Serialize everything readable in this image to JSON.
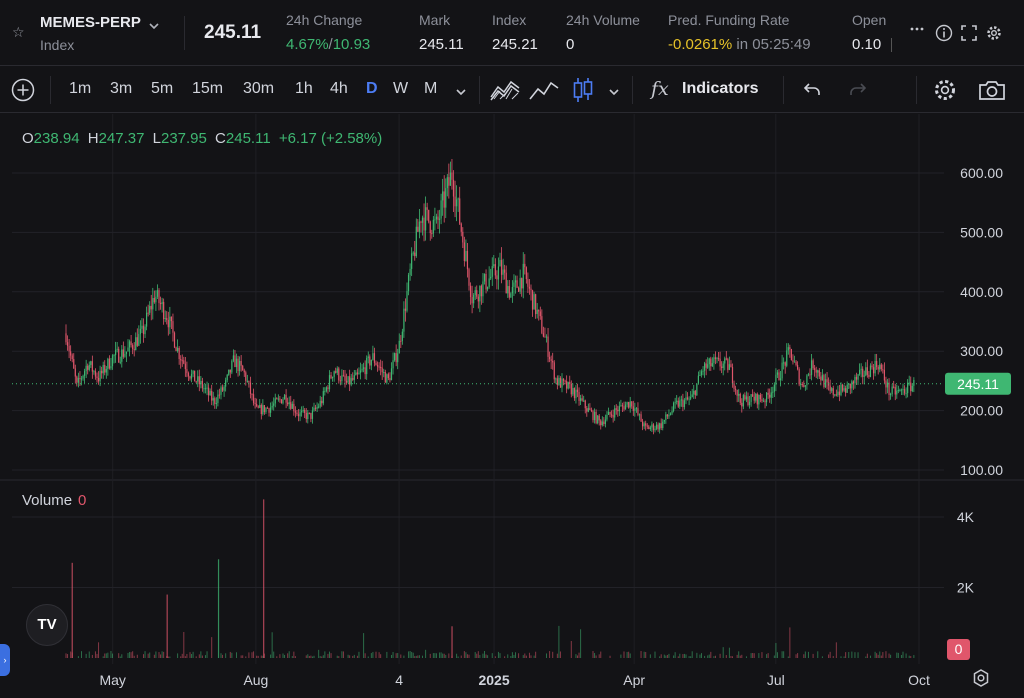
{
  "header": {
    "symbol": "MEMES-PERP",
    "symbol_sub": "Index",
    "last_price": "245.11",
    "change_label": "24h Change",
    "change_pct": "4.67%",
    "change_sep": "/",
    "change_abs": "10.93",
    "mark_label": "Mark",
    "mark_value": "245.11",
    "index_label": "Index",
    "index_value": "245.21",
    "volume_label": "24h Volume",
    "volume_value": "0",
    "funding_label": "Pred. Funding Rate",
    "funding_rate": "-0.0261%",
    "funding_in": "in 05:25:49",
    "open_label": "Open",
    "open_value": "0.10"
  },
  "icons": {
    "star": "star-icon",
    "chevron": "chevron-down-icon",
    "more": "more-icon",
    "info": "info-icon",
    "fullscreen": "fullscreen-icon",
    "settings": "gear-icon"
  },
  "toolbar": {
    "timeframes": [
      "1m",
      "3m",
      "5m",
      "15m",
      "30m",
      "1h",
      "4h",
      "D",
      "W",
      "M"
    ],
    "active_timeframe": "D",
    "indicators_label": "Indicators",
    "indicators_glyph": "fx"
  },
  "legend": {
    "o_key": "O",
    "o_val": "238.94",
    "h_key": "H",
    "h_val": "247.37",
    "l_key": "L",
    "l_val": "237.95",
    "c_key": "C",
    "c_val": "245.11",
    "change": "+6.17 (+2.58%)"
  },
  "volume_pane": {
    "label": "Volume",
    "value": "0",
    "badge": "0"
  },
  "logo": "TV",
  "colors": {
    "up": "#3fb772",
    "down": "#e0566b",
    "accent": "#4c7cf3",
    "funding": "#e6c229",
    "background": "#131316"
  },
  "chart_data": {
    "type": "candlestick",
    "price_axis_ticks": [
      "600.00",
      "500.00",
      "400.00",
      "300.00",
      "200.00",
      "100.00"
    ],
    "price_axis_values": [
      600,
      500,
      400,
      300,
      200,
      100
    ],
    "volume_axis_ticks": [
      "4K",
      "2K"
    ],
    "volume_axis_values": [
      4000,
      2000
    ],
    "time_axis_ticks": [
      "May",
      "Aug",
      "4",
      "2025",
      "Apr",
      "Jul",
      "Oct"
    ],
    "last_price_badge": "245.11",
    "last_price_value": 245.11,
    "close_path": [
      {
        "date": "2024-04-01",
        "close": 330
      },
      {
        "date": "2024-04-08",
        "close": 240
      },
      {
        "date": "2024-04-15",
        "close": 280
      },
      {
        "date": "2024-04-22",
        "close": 255
      },
      {
        "date": "2024-05-01",
        "close": 290
      },
      {
        "date": "2024-05-10",
        "close": 300
      },
      {
        "date": "2024-05-20",
        "close": 330
      },
      {
        "date": "2024-05-28",
        "close": 395
      },
      {
        "date": "2024-06-05",
        "close": 360
      },
      {
        "date": "2024-06-12",
        "close": 300
      },
      {
        "date": "2024-06-20",
        "close": 260
      },
      {
        "date": "2024-06-28",
        "close": 240
      },
      {
        "date": "2024-07-05",
        "close": 215
      },
      {
        "date": "2024-07-12",
        "close": 240
      },
      {
        "date": "2024-07-18",
        "close": 285
      },
      {
        "date": "2024-07-25",
        "close": 260
      },
      {
        "date": "2024-08-01",
        "close": 200
      },
      {
        "date": "2024-08-10",
        "close": 205
      },
      {
        "date": "2024-08-20",
        "close": 225
      },
      {
        "date": "2024-08-28",
        "close": 195
      },
      {
        "date": "2024-09-05",
        "close": 190
      },
      {
        "date": "2024-09-12",
        "close": 215
      },
      {
        "date": "2024-09-20",
        "close": 270
      },
      {
        "date": "2024-09-28",
        "close": 245
      },
      {
        "date": "2024-10-05",
        "close": 255
      },
      {
        "date": "2024-10-15",
        "close": 290
      },
      {
        "date": "2024-10-25",
        "close": 250
      },
      {
        "date": "2024-11-01",
        "close": 310
      },
      {
        "date": "2024-11-08",
        "close": 430
      },
      {
        "date": "2024-11-15",
        "close": 530
      },
      {
        "date": "2024-11-25",
        "close": 510
      },
      {
        "date": "2024-12-05",
        "close": 600
      },
      {
        "date": "2024-12-10",
        "close": 520
      },
      {
        "date": "2024-12-18",
        "close": 390
      },
      {
        "date": "2024-12-28",
        "close": 420
      },
      {
        "date": "2025-01-05",
        "close": 440
      },
      {
        "date": "2025-01-12",
        "close": 395
      },
      {
        "date": "2025-01-20",
        "close": 430
      },
      {
        "date": "2025-01-28",
        "close": 370
      },
      {
        "date": "2025-02-03",
        "close": 320
      },
      {
        "date": "2025-02-10",
        "close": 250
      },
      {
        "date": "2025-02-20",
        "close": 235
      },
      {
        "date": "2025-03-01",
        "close": 205
      },
      {
        "date": "2025-03-10",
        "close": 180
      },
      {
        "date": "2025-03-20",
        "close": 200
      },
      {
        "date": "2025-03-30",
        "close": 215
      },
      {
        "date": "2025-04-08",
        "close": 170
      },
      {
        "date": "2025-04-18",
        "close": 175
      },
      {
        "date": "2025-04-28",
        "close": 210
      },
      {
        "date": "2025-05-08",
        "close": 220
      },
      {
        "date": "2025-05-15",
        "close": 270
      },
      {
        "date": "2025-05-22",
        "close": 280
      },
      {
        "date": "2025-06-01",
        "close": 275
      },
      {
        "date": "2025-06-08",
        "close": 215
      },
      {
        "date": "2025-06-15",
        "close": 220
      },
      {
        "date": "2025-06-25",
        "close": 220
      },
      {
        "date": "2025-07-03",
        "close": 260
      },
      {
        "date": "2025-07-10",
        "close": 300
      },
      {
        "date": "2025-07-18",
        "close": 240
      },
      {
        "date": "2025-07-25",
        "close": 280
      },
      {
        "date": "2025-08-05",
        "close": 230
      },
      {
        "date": "2025-08-15",
        "close": 235
      },
      {
        "date": "2025-08-25",
        "close": 260
      },
      {
        "date": "2025-09-05",
        "close": 280
      },
      {
        "date": "2025-09-12",
        "close": 230
      },
      {
        "date": "2025-09-20",
        "close": 232
      },
      {
        "date": "2025-09-28",
        "close": 245
      }
    ],
    "volume_spikes": [
      {
        "date": "2024-04-05",
        "value": 2700,
        "dir": "down"
      },
      {
        "date": "2024-06-05",
        "value": 1800,
        "dir": "down"
      },
      {
        "date": "2024-07-08",
        "value": 2800,
        "dir": "up"
      },
      {
        "date": "2024-08-06",
        "value": 4500,
        "dir": "down"
      },
      {
        "date": "2024-12-05",
        "value": 900,
        "dir": "down"
      }
    ],
    "grid": true
  }
}
